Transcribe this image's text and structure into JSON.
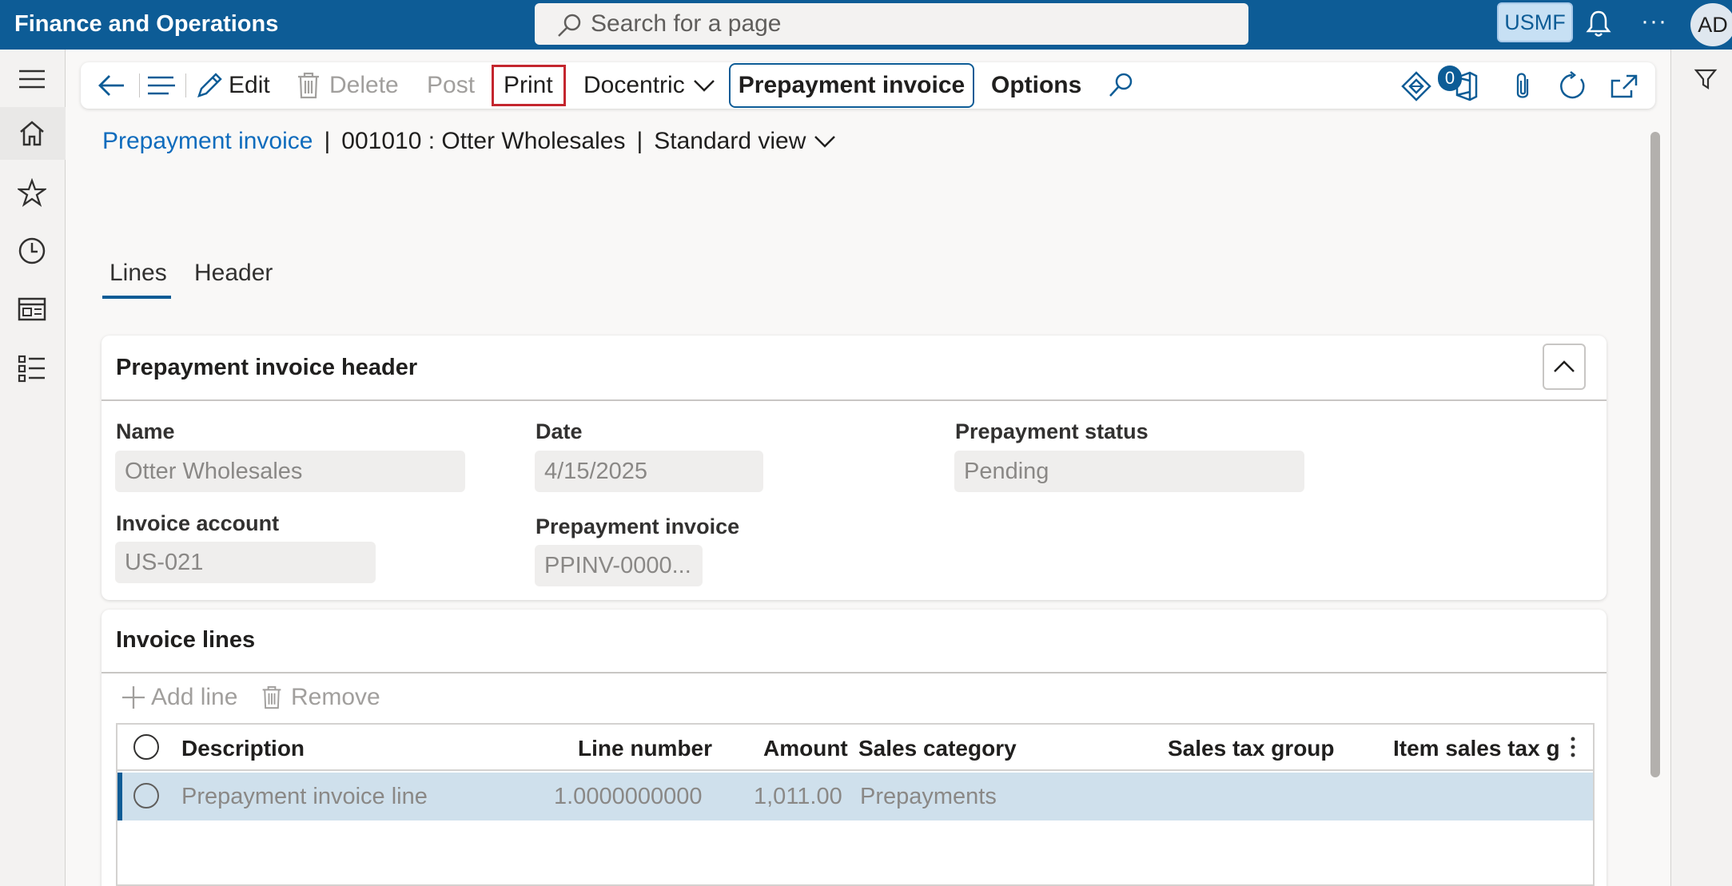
{
  "topbar": {
    "app_title": "Finance and Operations",
    "search_placeholder": "Search for a page",
    "company": "USMF",
    "avatar_initials": "AD",
    "more_label": "···"
  },
  "leftnav": {
    "items": [
      "menu-icon",
      "home-icon",
      "star-icon",
      "clock-icon",
      "workspace-icon",
      "list-icon"
    ]
  },
  "actionpane": {
    "edit_label": "Edit",
    "delete_label": "Delete",
    "post_label": "Post",
    "print_label": "Print",
    "docentric_label": "Docentric",
    "prepayment_tab_label": "Prepayment invoice",
    "options_label": "Options",
    "attachments_count": "0",
    "highlight_color": "#c4262e"
  },
  "breadcrumb": {
    "page_link": "Prepayment invoice",
    "separator": "|",
    "record": "001010 : Otter Wholesales",
    "view": "Standard view"
  },
  "tabs": {
    "lines": "Lines",
    "header": "Header"
  },
  "header_card": {
    "title": "Prepayment invoice header",
    "name_label": "Name",
    "name_value": "Otter Wholesales",
    "date_label": "Date",
    "date_value": "4/15/2025",
    "status_label": "Prepayment status",
    "status_value": "Pending",
    "invoice_account_label": "Invoice account",
    "invoice_account_value": "US-021",
    "prepayment_invoice_label": "Prepayment invoice",
    "prepayment_invoice_value": "PPINV-0000..."
  },
  "lines_card": {
    "title": "Invoice lines",
    "add_line_label": "Add line",
    "remove_label": "Remove",
    "columns": [
      "Description",
      "Line number",
      "Amount",
      "Sales category",
      "Sales tax group",
      "Item sales tax gr"
    ],
    "rows": [
      {
        "description": "Prepayment invoice line",
        "line_number": "1.0000000000",
        "amount": "1,011.00",
        "sales_category": "Prepayments",
        "sales_tax_group": "",
        "item_sales_tax_group": ""
      }
    ]
  },
  "colors": {
    "brand": "#0d5c96",
    "link": "#0f6cbd",
    "selected_row": "#cfe0ec"
  }
}
